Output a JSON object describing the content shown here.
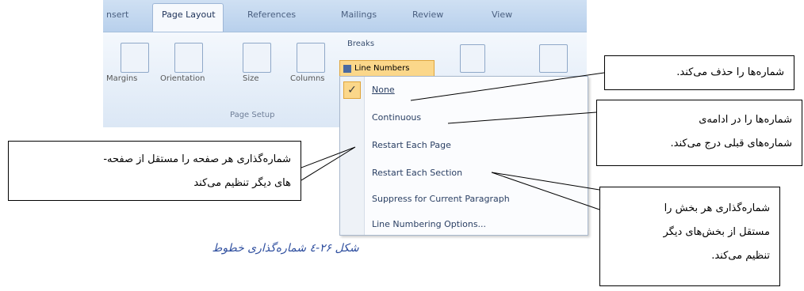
{
  "ribbon": {
    "tabs": [
      "nsert",
      "Page Layout",
      "References",
      "Mailings",
      "Review",
      "View"
    ],
    "active_tab": "Page Layout",
    "buttons": [
      "Margins",
      "Orientation",
      "Size",
      "Columns"
    ],
    "group_label": "Page Setup",
    "breaks_label": "Breaks",
    "line_numbers_label": "Line Numbers"
  },
  "menu": {
    "checked_item": "✓",
    "items": [
      "None",
      "Continuous",
      "Restart Each Page",
      "Restart Each Section",
      "Suppress for Current Paragraph",
      "Line Numbering Options..."
    ]
  },
  "callouts": {
    "none": [
      "شماره‌ها را حذف می‌کند."
    ],
    "continuous": [
      "شماره‌ها را در ادامه‌ی",
      "شماره‌های قبلی درج می‌کند."
    ],
    "restart_page": [
      "شماره‌گذاری هر صفحه را مستقل از صفحه-",
      "های دیگر تنظیم می‌کند"
    ],
    "restart_section": [
      "شماره‌گذاری هر بخش را",
      "مستقل از بخش‌های دیگر",
      "تنظیم می‌کند."
    ]
  },
  "caption": "شکل ۲۶-٤ شماره‌گذاری خطوط"
}
